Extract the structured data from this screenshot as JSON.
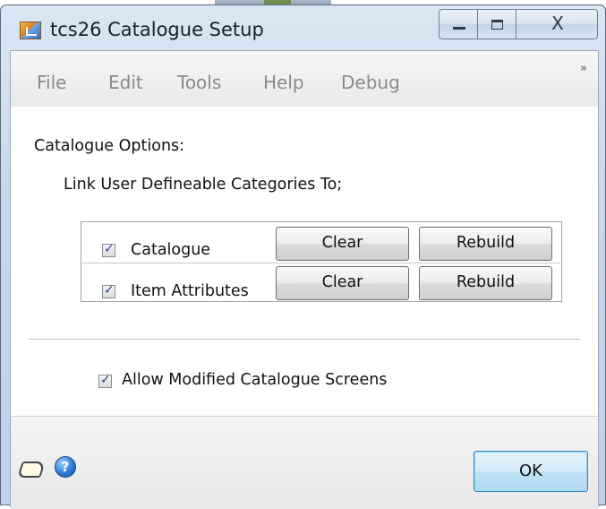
{
  "window": {
    "title": "tcs26 Catalogue Setup",
    "minimize_glyph": "▭",
    "maximize_glyph": "□",
    "close_glyph": "X"
  },
  "menu": {
    "items": [
      "File",
      "Edit",
      "Tools",
      "Help",
      "Debug"
    ],
    "overflow_glyph": "»"
  },
  "options": {
    "heading": "Catalogue  Options:",
    "link_label": "Link User Defineable Categories To;",
    "rows": [
      {
        "label": "Catalogue",
        "checked": true,
        "clear_label": "Clear",
        "rebuild_label": "Rebuild"
      },
      {
        "label": "Item Attributes",
        "checked": true,
        "clear_label": "Clear",
        "rebuild_label": "Rebuild"
      }
    ],
    "allow_modified_label": "Allow Modified Catalogue Screens",
    "allow_modified_checked": true,
    "check_glyph": "✓"
  },
  "footer": {
    "ok_label": "OK",
    "help_glyph": "?"
  },
  "colors": {
    "accent": "#2f86c7",
    "menu_text": "#8a8a8a",
    "titlebar": "#c7d8ec"
  }
}
